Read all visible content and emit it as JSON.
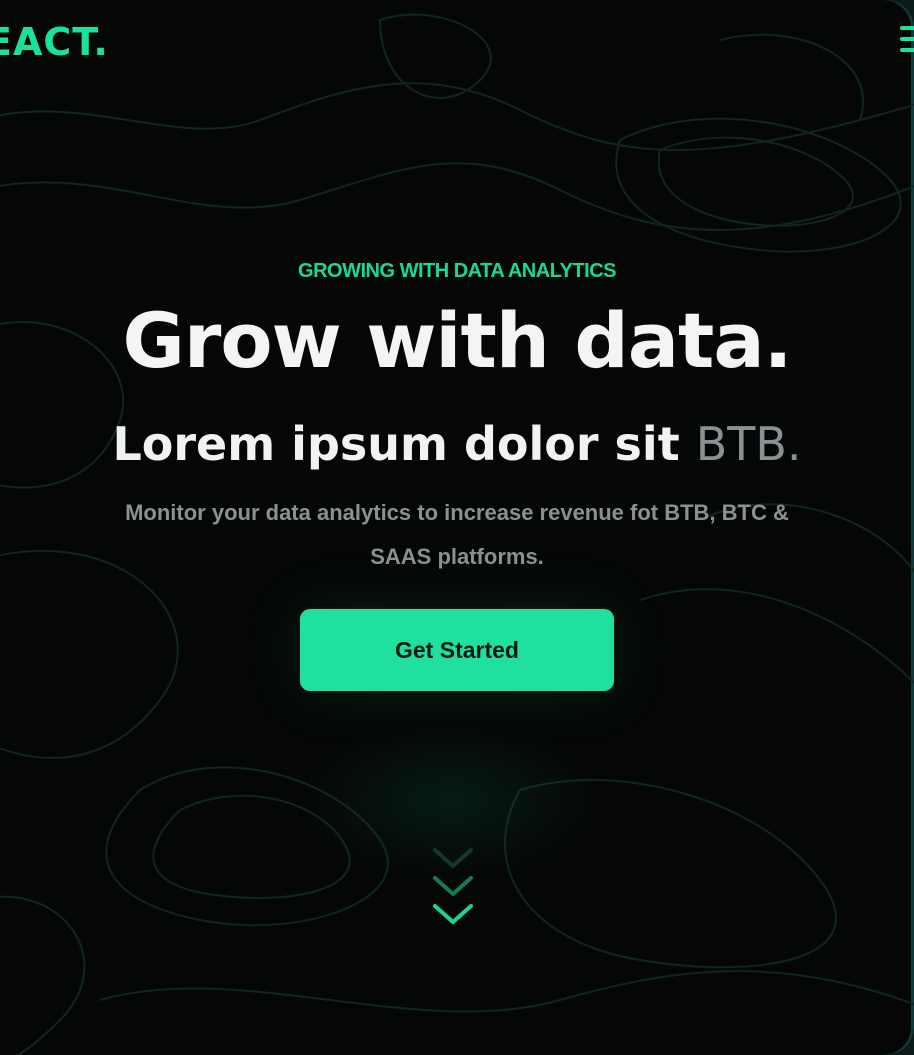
{
  "header": {
    "brand": "EACT.",
    "menu_icon": "hamburger-menu-icon"
  },
  "hero": {
    "eyebrow": "GROWING WITH DATA ANALYTICS",
    "headline": "Grow with data.",
    "subheadline_main": "Lorem ipsum dolor sit ",
    "subheadline_muted": "BTB.",
    "description_line1": "Monitor your data analytics to increase revenue fot BTB, BTC &",
    "description_line2": "SAAS platforms.",
    "cta_label": "Get Started",
    "scroll_icon": "chevron-down-icon"
  },
  "colors": {
    "background": "#050707",
    "accent": "#1fe0a0",
    "heading": "#f4f4f4",
    "muted": "#8b9095"
  }
}
